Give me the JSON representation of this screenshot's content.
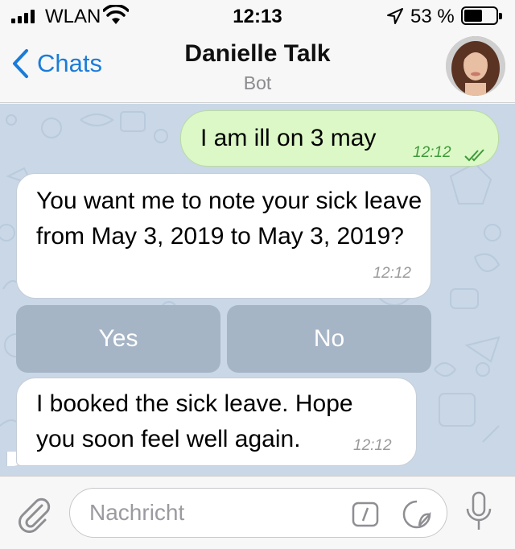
{
  "status_bar": {
    "carrier": "WLAN",
    "time": "12:13",
    "battery": "53 %",
    "battery_level": 0.53
  },
  "nav": {
    "back_label": "Chats",
    "title": "Danielle Talk",
    "subtitle": "Bot"
  },
  "messages": [
    {
      "direction": "outgoing",
      "text": "I am ill on 3 may",
      "time": "12:12",
      "status": "read"
    },
    {
      "direction": "incoming",
      "text": "You want me to note your sick leave from May 3, 2019 to May 3, 2019?",
      "time": "12:12"
    },
    {
      "direction": "incoming",
      "text": "I booked the sick leave. Hope you soon feel well again.",
      "time": "12:12"
    }
  ],
  "keyboard_buttons": [
    "Yes",
    "No"
  ],
  "input": {
    "placeholder": "Nachricht"
  },
  "colors": {
    "accent": "#1a7cd9",
    "outgoing_bubble": "#dcf8c6",
    "chat_background": "#c9d7e6",
    "keyboard_button": "#a6b5c6"
  },
  "icons": [
    "wifi-icon",
    "location-arrow-icon",
    "battery-icon",
    "back-chevron-icon",
    "double-check-icon",
    "paperclip-icon",
    "command-icon",
    "sticker-icon",
    "microphone-icon"
  ]
}
